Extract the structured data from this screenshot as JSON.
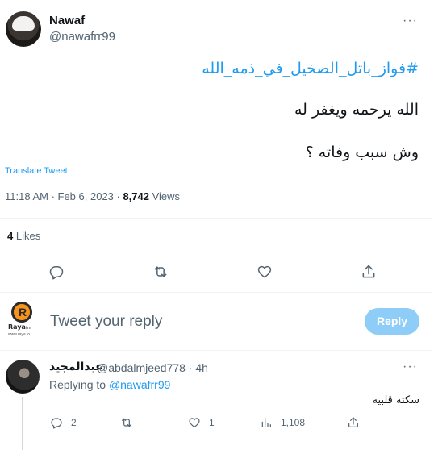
{
  "tweet": {
    "author": {
      "name": "Nawaf",
      "handle": "@nawafrr99"
    },
    "hashtag": "#فواز_باتل_الصخيل_في_ذمه_الله",
    "lines": [
      "الله يرحمه ويغفر له",
      "وش سبب وفاته ؟"
    ],
    "translate_label": "Translate Tweet",
    "time": "11:18 AM · Feb 6, 2023 · ",
    "views_count": "8,742",
    "views_label": " Views",
    "likes_count": "4",
    "likes_label": " Likes",
    "more": "···"
  },
  "composer": {
    "placeholder": "Tweet your reply",
    "button_label": "Reply",
    "logo_text": "Raya",
    "logo_fm": "fm",
    "logo_url": "www.raya.jo"
  },
  "reply": {
    "name": "عبدالمجيد",
    "handle_time": "@abdalmjeed778 · 4h",
    "replying_prefix": "Replying to ",
    "replying_to": "@nawafrr99",
    "text": "سكته قلبيه",
    "more": "···",
    "stats": {
      "replies": "2",
      "likes": "1",
      "views": "1,108"
    }
  },
  "icons": [
    "reply-icon",
    "retweet-icon",
    "like-icon",
    "share-icon",
    "views-icon",
    "more-icon"
  ],
  "colors": {
    "accent": "#1d9bf0",
    "reply_button_disabled": "#8ecdf8",
    "muted": "#536471"
  }
}
